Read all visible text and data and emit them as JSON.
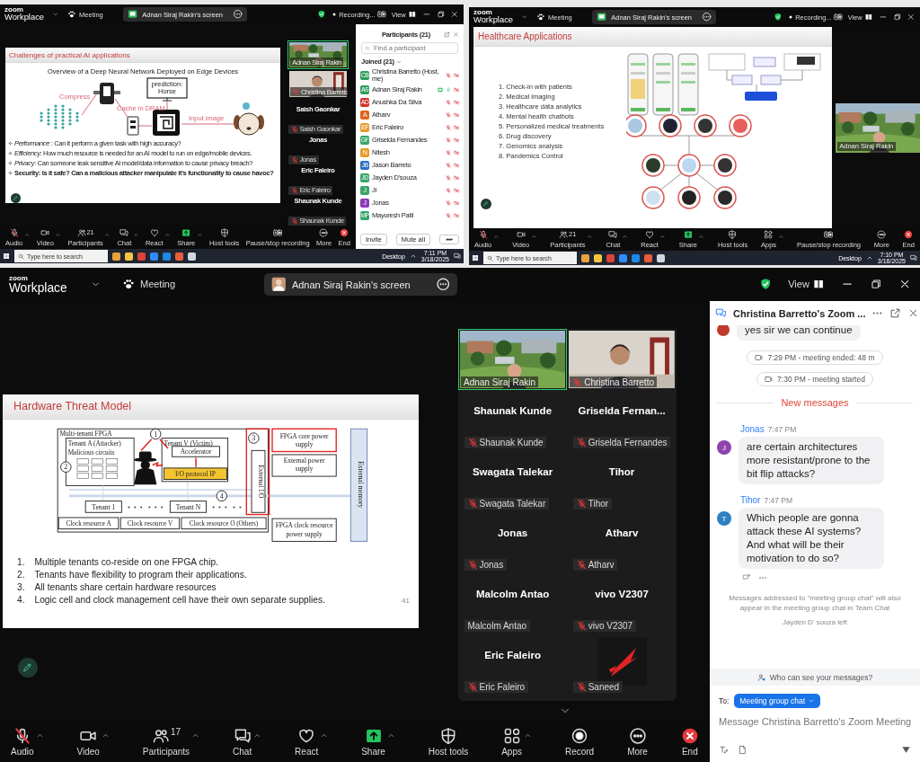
{
  "top_left": {
    "header": {
      "brand_top": "zoom",
      "brand": "Workplace",
      "meeting": "Meeting",
      "screen_label": "Adnan Siraj Rakin's screen",
      "recording": "Recording...",
      "view": "View"
    },
    "slide": {
      "title": "Challenges of practical AI applications",
      "subtitle": "Overview of a Deep Neural Network Deployed on Edge Devices",
      "labels": {
        "compress": "Compress",
        "cache": "Cache in DRAM",
        "prediction": [
          "prediction:",
          "Horse"
        ],
        "input": "Input image"
      },
      "bullets": [
        {
          "text": "*Performance* : Can it perform a given task with high accuracy?",
          "bold": false
        },
        {
          "text": "*Efficiency*: How much resource is needed for an AI model to run on edge/mobile devices.",
          "bold": false
        },
        {
          "text": "*Privacy*: Can someone leak sensitive AI model/data information to cause privacy breach?",
          "bold": false
        },
        {
          "text": "Security: Is it safe? Can a  malicious attacker manipulate it's functionality to cause havoc?",
          "bold": true
        }
      ]
    },
    "gallery": [
      {
        "kind": "video",
        "label": "Adnan Siraj Rakin",
        "muted": false,
        "active": true
      },
      {
        "kind": "video",
        "label": "Christina Barretto",
        "muted": true,
        "active": false
      },
      {
        "kind": "name",
        "title": "Saish Gaonkar",
        "label": "Saish Gaonkar",
        "muted": true
      },
      {
        "kind": "name",
        "title": "Jonas",
        "label": "Jonas",
        "muted": true
      },
      {
        "kind": "name",
        "title": "Eric Faleiro",
        "label": "Eric Faleiro",
        "muted": true
      },
      {
        "kind": "name",
        "title": "Shaunak Kunde",
        "label": "Shaunak Kunde",
        "muted": true
      }
    ],
    "participants": {
      "title": "Participants (21)",
      "placeholder": "Find a participant",
      "section": "Joined (21)",
      "buttons": [
        "Invite",
        "Mute all"
      ],
      "rows": [
        {
          "initials": "CB",
          "name": "Christina Barretto (Host, me)",
          "color": "#2e9e5b",
          "muted": true,
          "sharing": false
        },
        {
          "initials": "AS",
          "name": "Adnan Siraj Rakin",
          "color": "#2e9e5b",
          "muted": false,
          "sharing": true
        },
        {
          "initials": "AD",
          "name": "Anushka Da Silva",
          "color": "#d0342c",
          "muted": true,
          "sharing": false
        },
        {
          "initials": "A",
          "name": "Atharv",
          "color": "#e0651b",
          "muted": true,
          "sharing": false
        },
        {
          "initials": "EF",
          "name": "Eric Faleiro",
          "color": "#e89b2a",
          "muted": true,
          "sharing": false
        },
        {
          "initials": "GF",
          "name": "Griselda Fernandes",
          "color": "#36a467",
          "muted": true,
          "sharing": false
        },
        {
          "initials": "N",
          "name": "Nitesh",
          "color": "#e89b2a",
          "muted": true,
          "sharing": false
        },
        {
          "initials": "JB",
          "name": "Jason Barreto",
          "color": "#2d6cc0",
          "muted": true,
          "sharing": false
        },
        {
          "initials": "JD",
          "name": "Jayden D'souza",
          "color": "#36a467",
          "muted": true,
          "sharing": false
        },
        {
          "initials": "J",
          "name": "Ji",
          "color": "#36a467",
          "muted": true,
          "sharing": false
        },
        {
          "initials": "J",
          "name": "Jonas",
          "color": "#8a3ab9",
          "muted": true,
          "sharing": false
        },
        {
          "initials": "MP",
          "name": "Mayuresh Patil",
          "color": "#36a467",
          "muted": true,
          "sharing": false
        }
      ]
    },
    "toolbar": [
      {
        "kind": "audio",
        "label": "Audio",
        "caret": true,
        "muted": true
      },
      {
        "kind": "video",
        "label": "Video",
        "caret": true
      },
      {
        "kind": "participants",
        "label": "Participants",
        "caret": true,
        "count": "21"
      },
      {
        "kind": "chat",
        "label": "Chat",
        "caret": true
      },
      {
        "kind": "react",
        "label": "React",
        "caret": true
      },
      {
        "kind": "share",
        "label": "Share",
        "caret": true
      },
      {
        "kind": "host_tools",
        "label": "Host tools",
        "caret": false
      },
      {
        "kind": "recording",
        "label": "Pause/stop recording",
        "caret": false
      },
      {
        "kind": "more",
        "label": "More",
        "caret": false
      },
      {
        "kind": "end",
        "label": "End",
        "caret": false
      }
    ],
    "taskbar": {
      "placeholder": "Type here to search",
      "desktop": "Desktop",
      "time": "7:11 PM",
      "date": "3/18/2025"
    }
  },
  "top_right": {
    "header": {
      "brand_top": "zoom",
      "brand": "Workplace",
      "meeting": "Meeting",
      "screen_label": "Adnan Siraj Rakin's screen",
      "recording": "Recording...",
      "view": "View"
    },
    "slide": {
      "title": "Healthcare Applications",
      "items": [
        {
          "number": "1.",
          "text": "Check-in with patients"
        },
        {
          "number": "2.",
          "text": "Medical imaging"
        },
        {
          "number": "3.",
          "text": "Healthcare data analytics"
        },
        {
          "number": "4.",
          "text": "Mental health chatbots"
        },
        {
          "number": "5.",
          "text": "Personalized medical treatments"
        },
        {
          "number": "6.",
          "text": "Drug discovery"
        },
        {
          "number": "7.",
          "text": "Genomics analysis"
        },
        {
          "number": "8.",
          "text": "Pandemics Control"
        }
      ]
    },
    "video": {
      "label": "Adnan Siraj Rakin"
    },
    "toolbar": [
      {
        "kind": "audio",
        "label": "Audio",
        "caret": true,
        "muted": true
      },
      {
        "kind": "video",
        "label": "Video",
        "caret": true
      },
      {
        "kind": "participants",
        "label": "Participants",
        "caret": true,
        "count": "21"
      },
      {
        "kind": "chat",
        "label": "Chat",
        "caret": true
      },
      {
        "kind": "react",
        "label": "React",
        "caret": true
      },
      {
        "kind": "share",
        "label": "Share",
        "caret": true
      },
      {
        "kind": "host_tools",
        "label": "Host tools",
        "caret": false
      },
      {
        "kind": "apps",
        "label": "Apps",
        "caret": true
      },
      {
        "kind": "recording",
        "label": "Pause/stop recording",
        "caret": false
      },
      {
        "kind": "more",
        "label": "More",
        "caret": false
      },
      {
        "kind": "end",
        "label": "End",
        "caret": false
      }
    ],
    "taskbar": {
      "placeholder": "Type here to search",
      "desktop": "Desktop",
      "time": "7:10 PM",
      "date": "3/18/2025"
    }
  },
  "bottom": {
    "header": {
      "brand_top": "zoom",
      "brand": "Workplace",
      "meeting": "Meeting",
      "screen_label": "Adnan Siraj Rakin's screen",
      "view": "View"
    },
    "slide": {
      "title": "Hardware Threat Model",
      "page": "41",
      "labels": {
        "multi_tenant": "Multi-tenant FPGA",
        "attacker": "Tenant A (Attacker)",
        "malicious": "Malicious circuits",
        "victim": "Tenant V (Victim)",
        "accelerator": "Accelerator",
        "io_ip": "I/O protocol IP",
        "tenant_1": "Tenant 1",
        "tenant_n": "Tenant N",
        "clock_a": "Clock resource A",
        "clock_v": "Clock resource V",
        "clock_o": "Clock resource O (Others)",
        "core_power": [
          "FPGA core power",
          "supply"
        ],
        "ext_power": [
          "External power",
          "supply"
        ],
        "clock_power": [
          "FPGA clock resource",
          "power supply"
        ],
        "external_io": "External I/O",
        "external_memory": "External memory",
        "markers": [
          "1",
          "2",
          "3",
          "4"
        ]
      },
      "items": [
        {
          "number": "1.",
          "text": "Multiple tenants co-reside on one FPGA chip."
        },
        {
          "number": "2.",
          "text": "Tenants have flexibility to program their applications."
        },
        {
          "number": "3.",
          "text": "All tenants share certain hardware resources"
        },
        {
          "number": "4.",
          "text": "Logic cell and clock management cell have their own separate supplies."
        }
      ]
    },
    "gallery": [
      {
        "kind": "video",
        "label": "Adnan Siraj Rakin",
        "muted": false,
        "active": true
      },
      {
        "kind": "video",
        "label": "Christina Barretto",
        "muted": true,
        "active": false
      },
      {
        "kind": "name",
        "title": "Shaunak Kunde",
        "label": "Shaunak Kunde",
        "muted": true
      },
      {
        "kind": "name",
        "title": "Griselda  Fernan...",
        "label": "Griselda Fernandes",
        "muted": true
      },
      {
        "kind": "name",
        "title": "Swagata Talekar",
        "label": "Swagata Talekar",
        "muted": true
      },
      {
        "kind": "name",
        "title": "Tihor",
        "label": "Tihor",
        "muted": true
      },
      {
        "kind": "name",
        "title": "Jonas",
        "label": "Jonas",
        "muted": true
      },
      {
        "kind": "name",
        "title": "Atharv",
        "label": "Atharv",
        "muted": true
      },
      {
        "kind": "name",
        "title": "Malcolm Antao",
        "label": "Malcolm Antao",
        "muted": false
      },
      {
        "kind": "name",
        "title": "vivo V2307",
        "label": "vivo V2307",
        "muted": true
      },
      {
        "kind": "name",
        "title": "Eric Faleiro",
        "label": "Eric Faleiro",
        "muted": true
      },
      {
        "kind": "avatar",
        "label": "Saneed",
        "muted": true
      }
    ],
    "chat": {
      "title": "Christina Barretto's Zoom ...",
      "first_message": "yes sir we can continue",
      "events": [
        "7:29 PM - meeting ended: 48 m",
        "7:30 PM - meeting started"
      ],
      "new_label": "New messages",
      "messages": [
        {
          "sender": "Jonas",
          "time": "7:47 PM",
          "initial": "J",
          "color": "#8e44ad",
          "text": "are certain architectures more resistant/prone to the bit flip attacks?"
        },
        {
          "sender": "Tihor",
          "time": "7:47 PM",
          "initial": "T",
          "color": "#2f80c0",
          "text": "Which people are gonna attack these AI systems? And what will be their motivation to do so?"
        }
      ],
      "notice": "Messages addressed to \"meeting group chat\" will also appear in the meeting group chat in Team Chat",
      "left_note": "Jayden D' souza left",
      "visibility": "Who can see your messages?",
      "to_label": "To:",
      "recipient": "Meeting group chat",
      "placeholder": "Message Christina Barretto's Zoom Meeting"
    },
    "toolbar": [
      {
        "kind": "audio",
        "label": "Audio",
        "caret": true,
        "muted": true
      },
      {
        "kind": "video",
        "label": "Video",
        "caret": true
      },
      {
        "kind": "participants",
        "label": "Participants",
        "caret": true,
        "count": "17"
      },
      {
        "kind": "chat",
        "label": "Chat",
        "caret": true
      },
      {
        "kind": "react",
        "label": "React",
        "caret": true
      },
      {
        "kind": "share",
        "label": "Share",
        "caret": true
      },
      {
        "kind": "host_tools",
        "label": "Host tools",
        "caret": false
      },
      {
        "kind": "apps",
        "label": "Apps",
        "caret": true
      },
      {
        "kind": "record",
        "label": "Record",
        "caret": false
      },
      {
        "kind": "more",
        "label": "More",
        "caret": false
      },
      {
        "kind": "end",
        "label": "End",
        "caret": false
      }
    ]
  }
}
